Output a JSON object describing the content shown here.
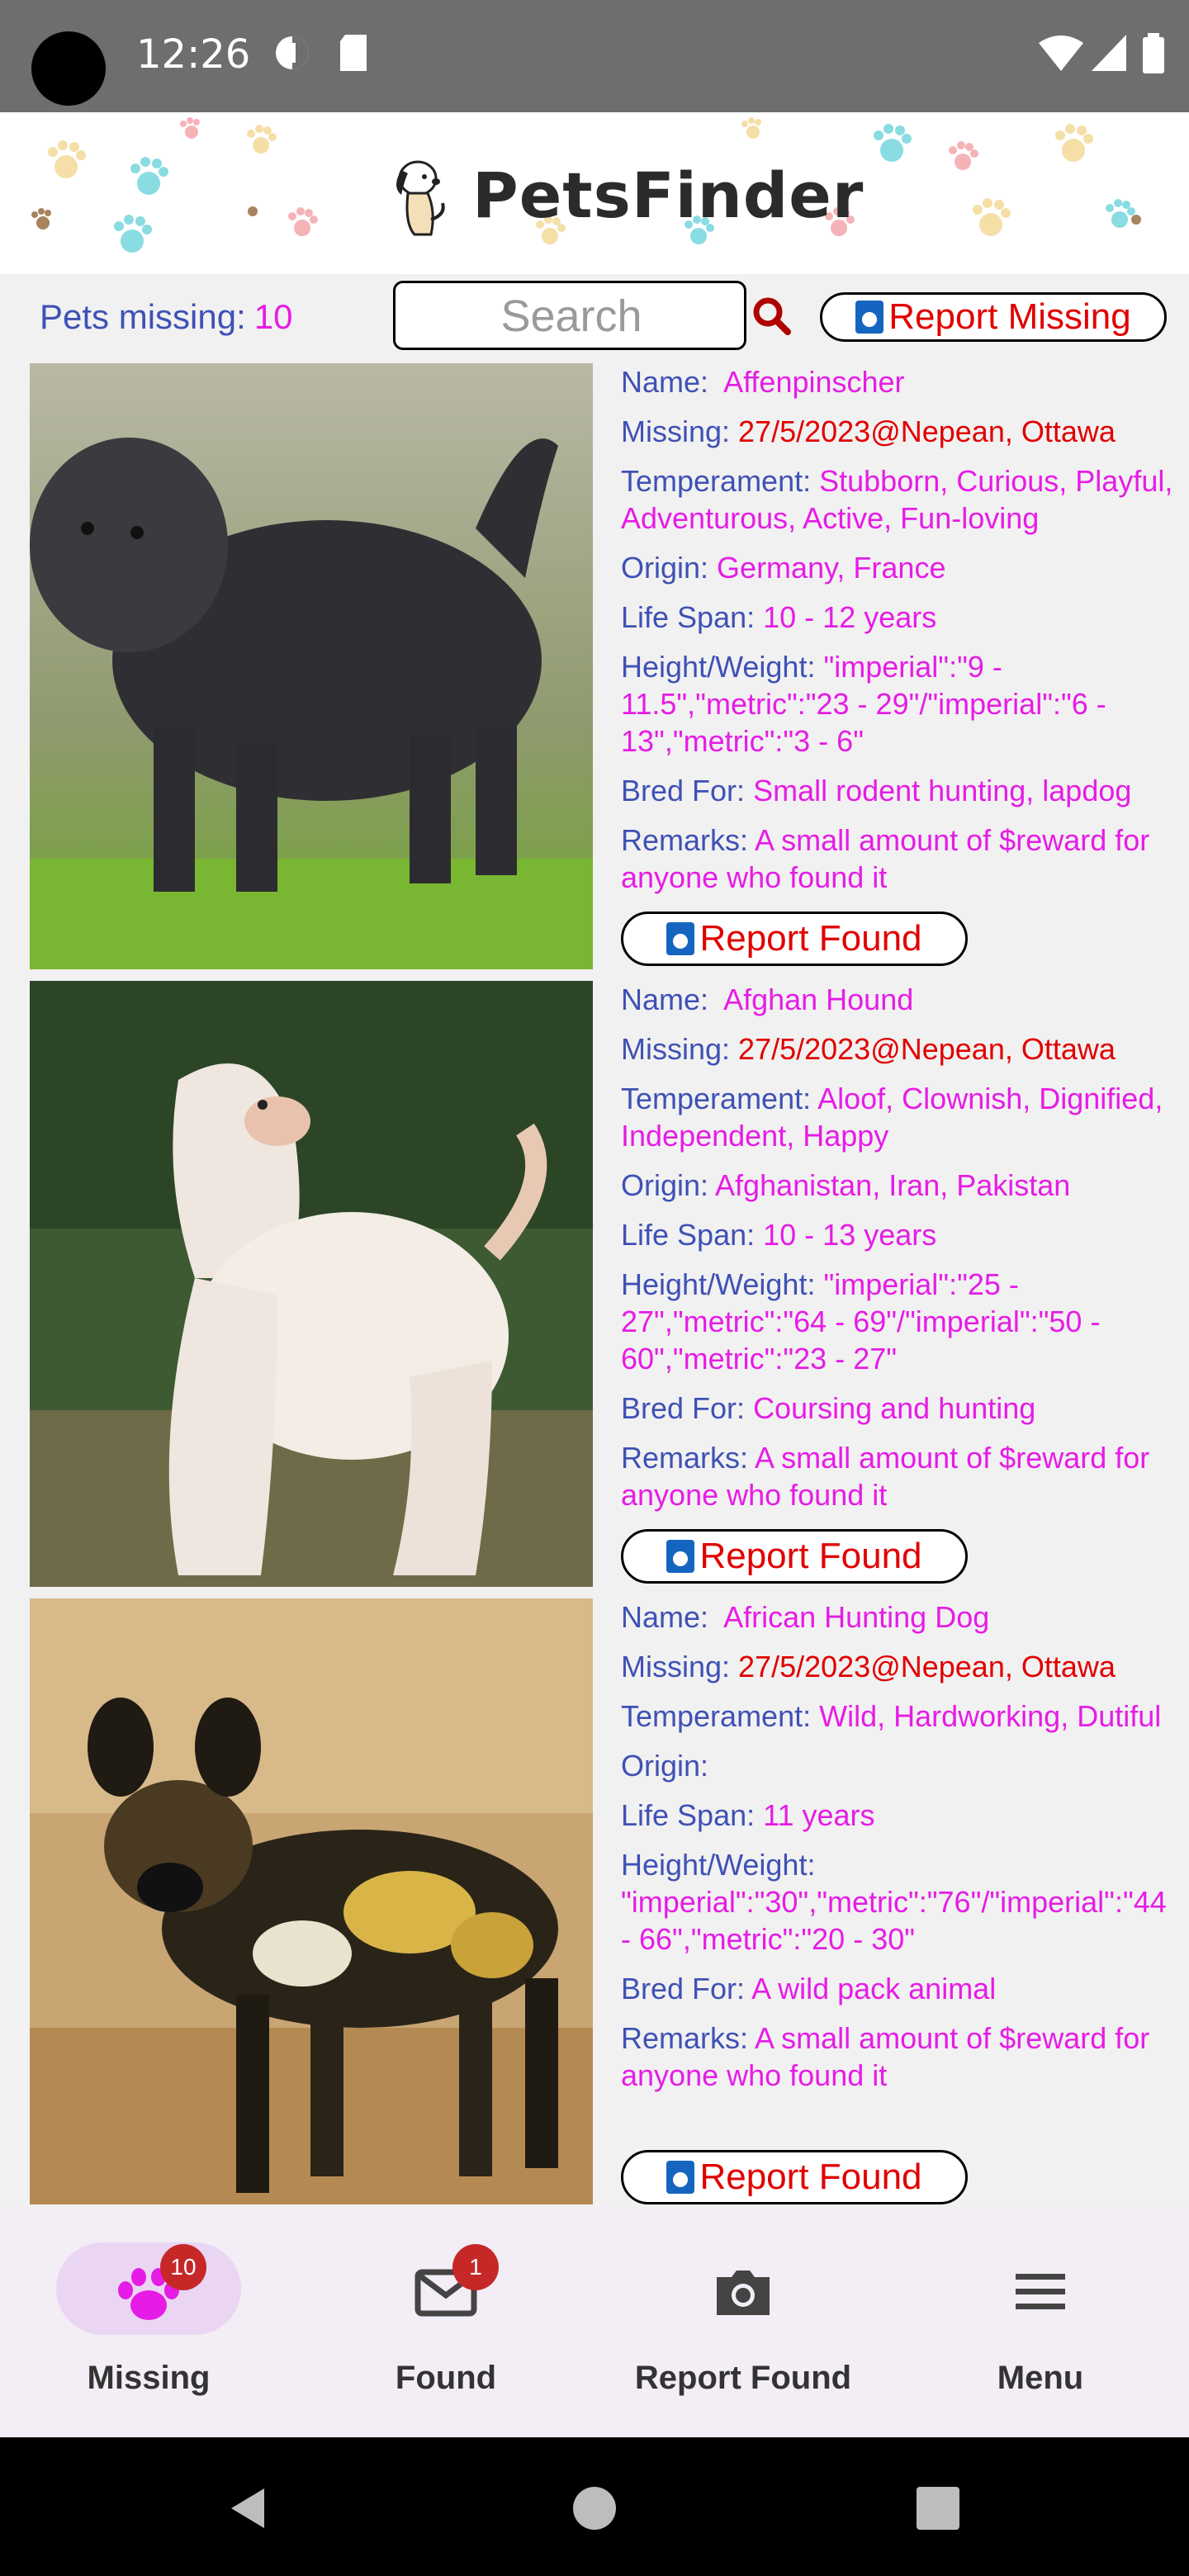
{
  "status_bar": {
    "time": "12:26"
  },
  "header": {
    "app_title": "PetsFinder"
  },
  "toolbar": {
    "pets_missing_label": "Pets missing:",
    "pets_missing_count": "10",
    "search_placeholder": "Search",
    "report_missing_label": "Report Missing"
  },
  "labels": {
    "name": "Name:",
    "missing": "Missing:",
    "temperament": "Temperament:",
    "origin": "Origin:",
    "life_span": "Life Span:",
    "height_weight": "Height/Weight:",
    "bred_for": "Bred For:",
    "remarks": "Remarks:",
    "report_found": "Report Found"
  },
  "pets": [
    {
      "name": "Affenpinscher",
      "missing": "27/5/2023@Nepean, Ottawa",
      "temperament": "Stubborn, Curious, Playful, Adventurous, Active, Fun-loving",
      "origin": "Germany, France",
      "life_span": "10 - 12 years",
      "height_weight": "\"imperial\":\"9 - 11.5\",\"metric\":\"23 - 29\"/\"imperial\":\"6 - 13\",\"metric\":\"3 - 6\"",
      "bred_for": "Small rodent hunting, lapdog",
      "remarks": "A small amount of $reward for anyone who found it"
    },
    {
      "name": "Afghan Hound",
      "missing": "27/5/2023@Nepean, Ottawa",
      "temperament": "Aloof, Clownish, Dignified, Independent, Happy",
      "origin": "Afghanistan, Iran, Pakistan",
      "life_span": "10 - 13 years",
      "height_weight": "\"imperial\":\"25 - 27\",\"metric\":\"64 - 69\"/\"imperial\":\"50 - 60\",\"metric\":\"23 - 27\"",
      "bred_for": "Coursing and hunting",
      "remarks": "A small amount of $reward for anyone who found it"
    },
    {
      "name": "African Hunting Dog",
      "missing": "27/5/2023@Nepean, Ottawa",
      "temperament": "Wild, Hardworking, Dutiful",
      "origin": "",
      "life_span": "11 years",
      "height_weight": "\"imperial\":\"30\",\"metric\":\"76\"/\"imperial\":\"44 - 66\",\"metric\":\"20 - 30\"",
      "bred_for": "A wild pack animal",
      "remarks": "A small amount of $reward for anyone who found it"
    }
  ],
  "bottom_nav": {
    "items": [
      {
        "label": "Missing",
        "badge": "10",
        "icon": "paw-icon"
      },
      {
        "label": "Found",
        "badge": "1",
        "icon": "mail-icon"
      },
      {
        "label": "Report Found",
        "icon": "camera-icon"
      },
      {
        "label": "Menu",
        "icon": "menu-icon"
      }
    ]
  },
  "colors": {
    "label": "#3f51b5",
    "value": "#e61ce6",
    "alert": "#e10000",
    "nav_background": "#f3edf6",
    "nav_active_pill": "#ead6f3"
  }
}
